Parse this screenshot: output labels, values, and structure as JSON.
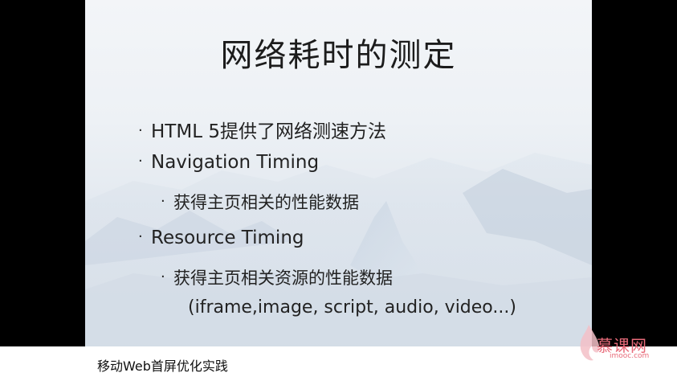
{
  "slide": {
    "title": "网络耗时的测定",
    "bullets": [
      "HTML 5提供了网络测速方法",
      "Navigation Timing",
      "获得主页相关的性能数据",
      "Resource Timing",
      "获得主页相关资源的性能数据",
      "(iframe,image, script, audio, video...)"
    ],
    "bullet_glyph": "·"
  },
  "footer": {
    "caption": "移动Web首屏优化实践"
  },
  "watermark": {
    "brand": "慕课网",
    "domain": "imooc.com",
    "color": "#e86b7a"
  }
}
